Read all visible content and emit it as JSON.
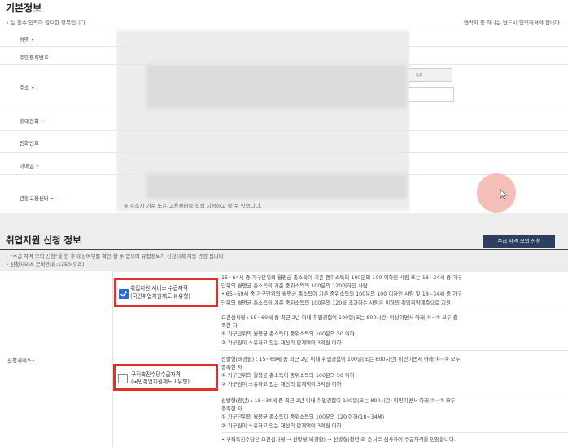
{
  "basic": {
    "title": "기본정보",
    "required_note": "는 필수 입력이 필요한 항목입니다",
    "contact_note": "연락처 중 하나는 반드시 입력하셔야 합니다.",
    "fields": [
      {
        "label": "성명",
        "required": true
      },
      {
        "label": "주민등록번호",
        "required": false
      },
      {
        "label": "주소",
        "required": true
      },
      {
        "label": "휴대전화",
        "required": true
      },
      {
        "label": "전화번호",
        "required": false
      },
      {
        "label": "이메일",
        "required": true
      },
      {
        "label": "관할고용센터",
        "required": true
      }
    ],
    "address_number": "55",
    "center_note": "※ 주소지 기준 또는 고용센터를 직접 지정하고 할 수 있습니다."
  },
  "apply": {
    "title": "취업지원 신청 정보",
    "mock_button": "수급 자격 모의 신청",
    "note1": "\"수급 자격 모의 신청\"을 한 후 대상여부를 확인 할 수 있으며 유형정보가 신청서에 자동 반영 됩니다",
    "note2": "신청서비스 문의안내 :1350(유료)",
    "service_label": "신청서비스",
    "option1": {
      "line1": "취업지원 서비스 수급자격",
      "line2": "(국민취업지원제도 II 유형)",
      "checked": true
    },
    "option2": {
      "line1": "구직촉진수당수급자격",
      "line2": "(국민취업지원제도 I 유형)",
      "checked": false
    },
    "desc1": [
      "15~64세 중 가구단위의 월평균 총소득이 기준 중위소득의 100분의 100 이하인 사람 또는 18~34세 중 가구",
      "단위의 월평균 총소득이 기준 중위소득의 100분의 120이하인 사람",
      "• 65~69세 중 가구단위의 월평균 총소득이 기준 중위소득의 100분의 100 이하인 사람 및 18~34세 중 가구",
      "단위의 월평균 총소득이 기준 중위소득의 100분의 120을 초과하는 사람은 이하의 취업취약계층으로 지원"
    ],
    "desc2": [
      "요건심사형 : 15~69세 중 최근 2년 이내 취업경험이 100일(또는 800시간) 이상이면서 아래 ①~② 모두 충",
      "족한 자",
      "① 가구단위의 월평균 총소득이 중위소득의 100분의 50 이하",
      "② 가구원이 소유하고 있는 재산의 합계액이 3억원 이하"
    ],
    "desc3": [
      "선발형(비경활) : 15~69세 중 최근 2년 이내 취업경험이 100일(또는 800시간) 미만이면서 아래 ①~② 모두",
      "충족한 자",
      "① 가구단위의 월평균 총소득이 중위소득의 100분의 50 이하",
      "② 가구원이 소유하고 있는 재산의 합계액이 3억원 이하"
    ],
    "desc4": [
      "선발형(청년) : 18~34세 중 최근 2년 이내 취업경험이 100일(또는 800시간) 미만이면서 아래 ①~② 모두",
      "충족한 자",
      "① 가구단위의 월평균 총소득이 중위소득의 100분의 120 이하(18~34세)",
      "② 가구원이 소유하고 있는 재산의 합계액이 3억원 이하"
    ],
    "desc5": "• 구직촉진수당은 요건심사형 → 선발형(비경활) → 선발형(청년)의 순서로 심사하여 수급자격을 인정합니다."
  }
}
